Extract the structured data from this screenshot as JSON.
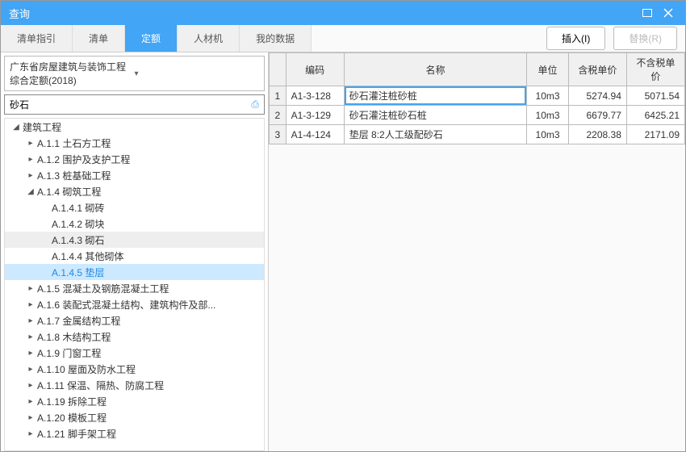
{
  "window": {
    "title": "查询"
  },
  "tabs": [
    "清单指引",
    "清单",
    "定额",
    "人材机",
    "我的数据"
  ],
  "activeTab": 2,
  "buttons": {
    "insert": "插入(I)",
    "replace": "替换(R)"
  },
  "dropdown": {
    "label": "广东省房屋建筑与装饰工程综合定额(2018)"
  },
  "searchValue": "砂石",
  "tree": [
    {
      "label": "建筑工程",
      "depth": 0,
      "expanded": true
    },
    {
      "label": "A.1.1 土石方工程",
      "depth": 1,
      "expanded": false
    },
    {
      "label": "A.1.2 围护及支护工程",
      "depth": 1,
      "expanded": false
    },
    {
      "label": "A.1.3 桩基础工程",
      "depth": 1,
      "expanded": false
    },
    {
      "label": "A.1.4 砌筑工程",
      "depth": 1,
      "expanded": true
    },
    {
      "label": "A.1.4.1 砌砖",
      "depth": 2,
      "leaf": true
    },
    {
      "label": "A.1.4.2 砌块",
      "depth": 2,
      "leaf": true
    },
    {
      "label": "A.1.4.3 砌石",
      "depth": 2,
      "leaf": true,
      "highlighted": true
    },
    {
      "label": "A.1.4.4 其他砌体",
      "depth": 2,
      "leaf": true
    },
    {
      "label": "A.1.4.5 垫层",
      "depth": 2,
      "leaf": true,
      "selected": true
    },
    {
      "label": "A.1.5 混凝土及钢筋混凝土工程",
      "depth": 1,
      "expanded": false
    },
    {
      "label": "A.1.6 装配式混凝土结构、建筑构件及部...",
      "depth": 1,
      "expanded": false
    },
    {
      "label": "A.1.7 金属结构工程",
      "depth": 1,
      "expanded": false
    },
    {
      "label": "A.1.8 木结构工程",
      "depth": 1,
      "expanded": false
    },
    {
      "label": "A.1.9 门窗工程",
      "depth": 1,
      "expanded": false
    },
    {
      "label": "A.1.10 屋面及防水工程",
      "depth": 1,
      "expanded": false
    },
    {
      "label": "A.1.11 保温、隔热、防腐工程",
      "depth": 1,
      "expanded": false
    },
    {
      "label": "A.1.19 拆除工程",
      "depth": 1,
      "expanded": false
    },
    {
      "label": "A.1.20 模板工程",
      "depth": 1,
      "expanded": false
    },
    {
      "label": "A.1.21 脚手架工程",
      "depth": 1,
      "expanded": false
    }
  ],
  "grid": {
    "headers": [
      "编码",
      "名称",
      "单位",
      "含税单价",
      "不含税单价"
    ],
    "rows": [
      {
        "n": 1,
        "code": "A1-3-128",
        "name": "砂石灌注桩砂桩",
        "unit": "10m3",
        "p1": "5274.94",
        "p2": "5071.54",
        "active": true
      },
      {
        "n": 2,
        "code": "A1-3-129",
        "name": "砂石灌注桩砂石桩",
        "unit": "10m3",
        "p1": "6679.77",
        "p2": "6425.21"
      },
      {
        "n": 3,
        "code": "A1-4-124",
        "name": "垫层 8:2人工级配砂石",
        "unit": "10m3",
        "p1": "2208.38",
        "p2": "2171.09"
      }
    ]
  }
}
